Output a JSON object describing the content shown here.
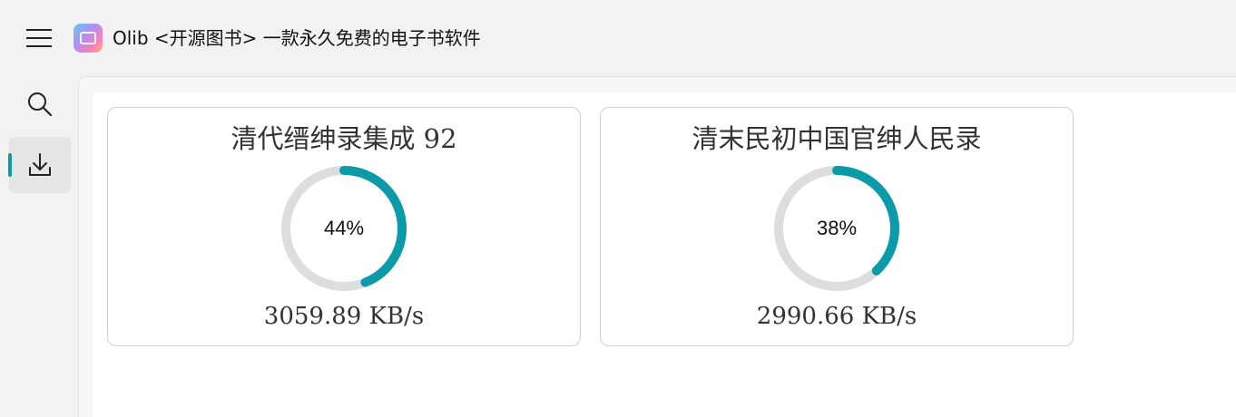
{
  "app": {
    "title": "Olib <开源图书> 一款永久免费的电子书软件",
    "menu_icon": "hamburger-menu-icon",
    "logo_icon": "app-logo-icon"
  },
  "sidebar": {
    "items": [
      {
        "name": "search",
        "icon": "search-icon",
        "active": false
      },
      {
        "name": "downloads",
        "icon": "download-icon",
        "active": true
      }
    ]
  },
  "colors": {
    "accent": "#0a9aa8",
    "ring_track": "#dddddd"
  },
  "downloads": [
    {
      "title": "清代缙绅录集成 92",
      "progress": 44,
      "progress_label": "44%",
      "speed": "3059.89 KB/s"
    },
    {
      "title": "清末民初中国官绅人民录",
      "progress": 38,
      "progress_label": "38%",
      "speed": "2990.66 KB/s"
    }
  ]
}
